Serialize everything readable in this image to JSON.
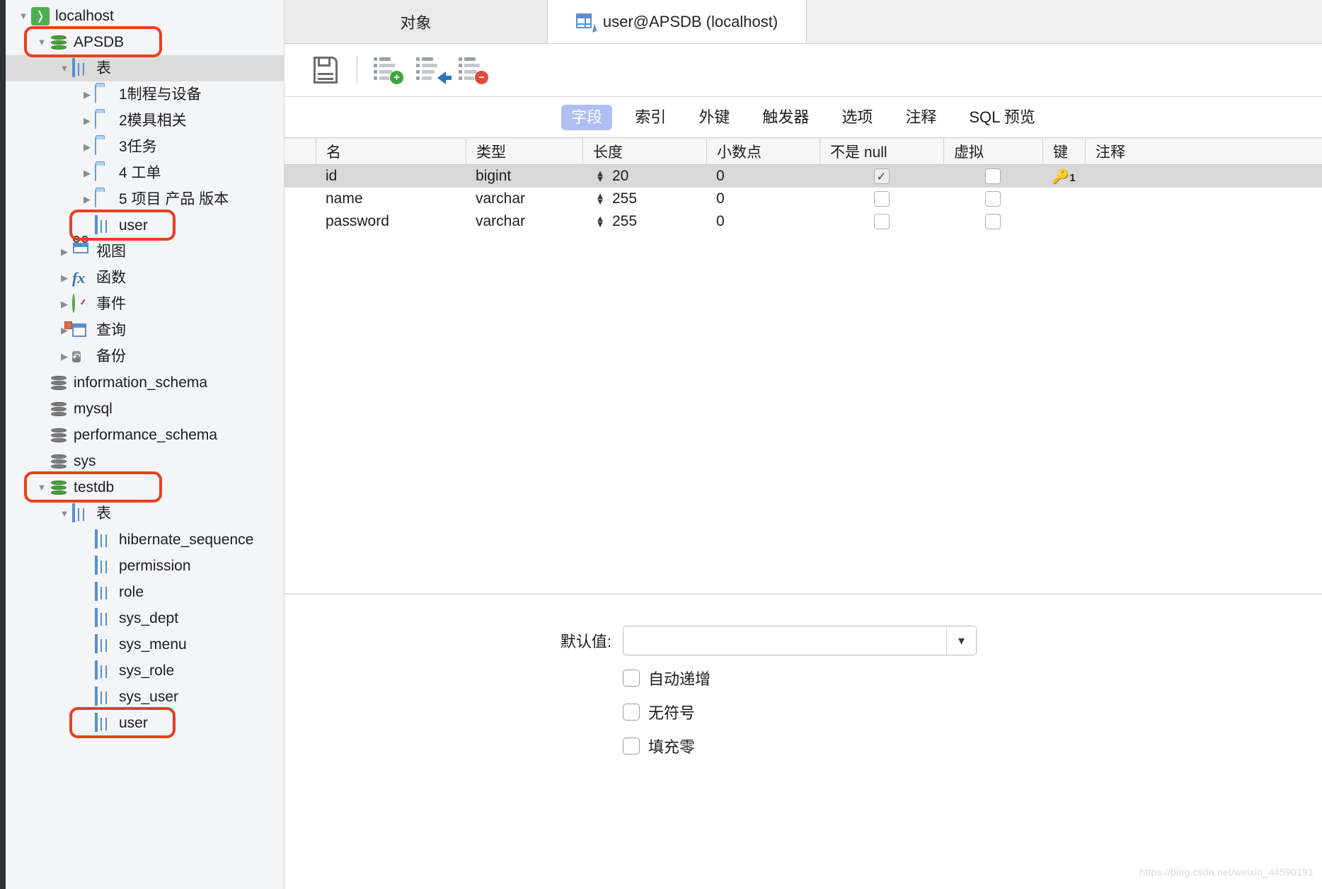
{
  "sidebar": {
    "items": [
      {
        "label": "localhost",
        "indent": 0,
        "twisty": "open",
        "icon": "dolphin-icon"
      },
      {
        "label": "APSDB",
        "indent": 1,
        "twisty": "open",
        "icon": "database-green-icon",
        "ring": true
      },
      {
        "label": "表",
        "indent": 2,
        "twisty": "open",
        "icon": "table-icon",
        "selected": true
      },
      {
        "label": "1制程与设备",
        "indent": 3,
        "twisty": "closed",
        "icon": "folder-icon"
      },
      {
        "label": "2模具相关",
        "indent": 3,
        "twisty": "closed",
        "icon": "folder-icon"
      },
      {
        "label": "3任务",
        "indent": 3,
        "twisty": "closed",
        "icon": "folder-icon"
      },
      {
        "label": "4 工单",
        "indent": 3,
        "twisty": "closed",
        "icon": "folder-icon"
      },
      {
        "label": "5 项目 产品 版本",
        "indent": 3,
        "twisty": "closed",
        "icon": "folder-icon"
      },
      {
        "label": "user",
        "indent": 3,
        "twisty": "none",
        "icon": "table-icon",
        "ring": true
      },
      {
        "label": "视图",
        "indent": 2,
        "twisty": "closed",
        "icon": "view-icon"
      },
      {
        "label": "函数",
        "indent": 2,
        "twisty": "closed",
        "icon": "function-icon"
      },
      {
        "label": "事件",
        "indent": 2,
        "twisty": "closed",
        "icon": "event-clock-icon"
      },
      {
        "label": "查询",
        "indent": 2,
        "twisty": "closed",
        "icon": "query-icon"
      },
      {
        "label": "备份",
        "indent": 2,
        "twisty": "closed",
        "icon": "backup-icon"
      },
      {
        "label": "information_schema",
        "indent": 1,
        "twisty": "none",
        "icon": "database-gray-icon"
      },
      {
        "label": "mysql",
        "indent": 1,
        "twisty": "none",
        "icon": "database-gray-icon"
      },
      {
        "label": "performance_schema",
        "indent": 1,
        "twisty": "none",
        "icon": "database-gray-icon"
      },
      {
        "label": "sys",
        "indent": 1,
        "twisty": "none",
        "icon": "database-gray-icon"
      },
      {
        "label": "testdb",
        "indent": 1,
        "twisty": "open",
        "icon": "database-green-icon",
        "ring": true
      },
      {
        "label": "表",
        "indent": 2,
        "twisty": "open",
        "icon": "table-icon"
      },
      {
        "label": "hibernate_sequence",
        "indent": 3,
        "twisty": "none",
        "icon": "table-icon"
      },
      {
        "label": "permission",
        "indent": 3,
        "twisty": "none",
        "icon": "table-icon"
      },
      {
        "label": "role",
        "indent": 3,
        "twisty": "none",
        "icon": "table-icon"
      },
      {
        "label": "sys_dept",
        "indent": 3,
        "twisty": "none",
        "icon": "table-icon"
      },
      {
        "label": "sys_menu",
        "indent": 3,
        "twisty": "none",
        "icon": "table-icon"
      },
      {
        "label": "sys_role",
        "indent": 3,
        "twisty": "none",
        "icon": "table-icon"
      },
      {
        "label": "sys_user",
        "indent": 3,
        "twisty": "none",
        "icon": "table-icon"
      },
      {
        "label": "user",
        "indent": 3,
        "twisty": "none",
        "icon": "table-icon",
        "ring": true
      }
    ]
  },
  "tabs": {
    "objects_label": "对象",
    "editor_label": "user@APSDB (localhost)",
    "editor_icon": "table-edit-icon"
  },
  "toolbar": {
    "save_icon": "save-icon",
    "add_field_icon": "add-field-icon",
    "insert_field_icon": "insert-field-icon",
    "delete_field_icon": "delete-field-icon"
  },
  "subtabs": [
    {
      "label": "字段",
      "active": true
    },
    {
      "label": "索引",
      "active": false
    },
    {
      "label": "外键",
      "active": false
    },
    {
      "label": "触发器",
      "active": false
    },
    {
      "label": "选项",
      "active": false
    },
    {
      "label": "注释",
      "active": false
    },
    {
      "label": "SQL 预览",
      "active": false
    }
  ],
  "grid": {
    "columns": [
      "名",
      "类型",
      "长度",
      "小数点",
      "不是 null",
      "虚拟",
      "键",
      "注释"
    ],
    "rows": [
      {
        "name": "id",
        "type": "bigint",
        "length": "20",
        "decimals": "0",
        "not_null": true,
        "virtual": false,
        "key": "1",
        "comment": "",
        "selected": true
      },
      {
        "name": "name",
        "type": "varchar",
        "length": "255",
        "decimals": "0",
        "not_null": false,
        "virtual": false,
        "key": "",
        "comment": "",
        "selected": false
      },
      {
        "name": "password",
        "type": "varchar",
        "length": "255",
        "decimals": "0",
        "not_null": false,
        "virtual": false,
        "key": "",
        "comment": "",
        "selected": false
      }
    ]
  },
  "form": {
    "default_label": "默认值:",
    "default_value": "",
    "default_placeholder": "",
    "dropdown_icon": "chevron-down-icon",
    "checkboxes": [
      {
        "label": "自动递增",
        "checked": false
      },
      {
        "label": "无符号",
        "checked": false
      },
      {
        "label": "填充零",
        "checked": false
      }
    ]
  },
  "watermark": "https://blog.csdn.net/weixin_44590191",
  "colors": {
    "accent": "#aebff3",
    "annotation": "#e8401f",
    "selection": "#d8d8d8"
  }
}
